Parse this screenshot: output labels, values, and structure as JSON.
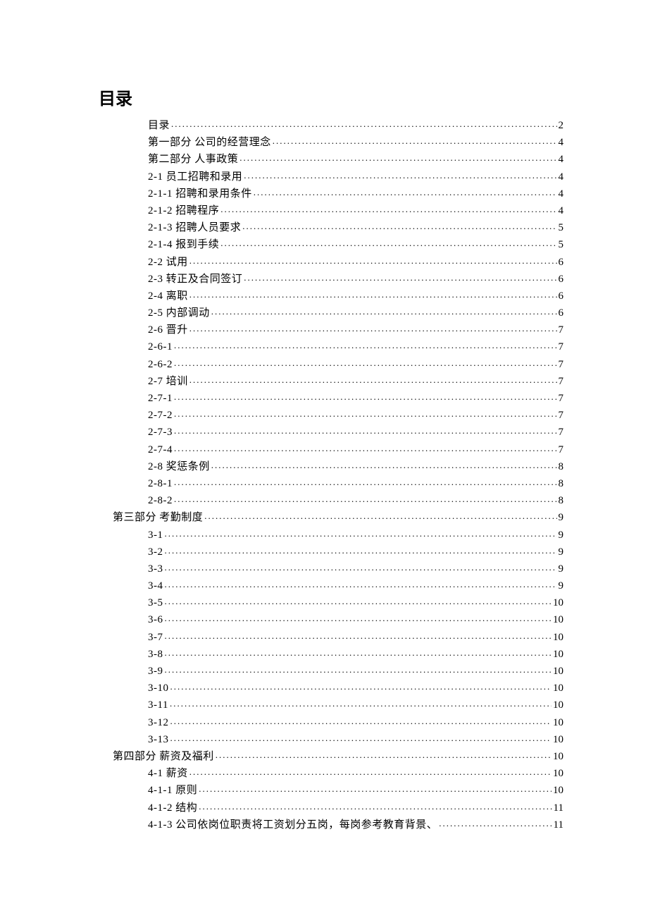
{
  "heading": "目录",
  "toc": [
    {
      "label": "目录",
      "page": "2",
      "indent": 1
    },
    {
      "label": "第一部分  公司的经营理念",
      "page": "4",
      "indent": 1
    },
    {
      "label": "第二部分  人事政策",
      "page": "4",
      "indent": 1
    },
    {
      "label": "2-1  员工招聘和录用",
      "page": "4",
      "indent": 1
    },
    {
      "label": "2-1-1  招聘和录用条件",
      "page": "4",
      "indent": 1
    },
    {
      "label": "2-1-2  招聘程序",
      "page": "4",
      "indent": 1
    },
    {
      "label": "2-1-3  招聘人员要求",
      "page": "5",
      "indent": 1
    },
    {
      "label": "2-1-4  报到手续",
      "page": "5",
      "indent": 1
    },
    {
      "label": "2-2  试用",
      "page": "6",
      "indent": 1
    },
    {
      "label": "2-3  转正及合同签订",
      "page": "6",
      "indent": 1
    },
    {
      "label": "2-4  离职",
      "page": "6",
      "indent": 1
    },
    {
      "label": "2-5  内部调动",
      "page": "6",
      "indent": 1
    },
    {
      "label": "2-6  晋升",
      "page": "7",
      "indent": 1
    },
    {
      "label": "2-6-1",
      "page": "7",
      "indent": 1
    },
    {
      "label": "2-6-2",
      "page": "7",
      "indent": 1
    },
    {
      "label": "2-7  培训",
      "page": "7",
      "indent": 1
    },
    {
      "label": "2-7-1",
      "page": "7",
      "indent": 1
    },
    {
      "label": "2-7-2",
      "page": "7",
      "indent": 1
    },
    {
      "label": "2-7-3",
      "page": "7",
      "indent": 1
    },
    {
      "label": "2-7-4",
      "page": "7",
      "indent": 1
    },
    {
      "label": "2-8  奖惩条例",
      "page": "8",
      "indent": 1
    },
    {
      "label": "2-8-1",
      "page": "8",
      "indent": 1
    },
    {
      "label": "2-8-2",
      "page": "8",
      "indent": 1
    },
    {
      "label": "第三部分  考勤制度",
      "page": "9",
      "indent": 0
    },
    {
      "label": "3-1",
      "page": "9",
      "indent": 1
    },
    {
      "label": "3-2",
      "page": "9",
      "indent": 1
    },
    {
      "label": "3-3",
      "page": "9",
      "indent": 1
    },
    {
      "label": "3-4",
      "page": "9",
      "indent": 1
    },
    {
      "label": "3-5",
      "page": "10",
      "indent": 1
    },
    {
      "label": "3-6",
      "page": "10",
      "indent": 1
    },
    {
      "label": "3-7",
      "page": "10",
      "indent": 1
    },
    {
      "label": "3-8",
      "page": "10",
      "indent": 1
    },
    {
      "label": "3-9",
      "page": "10",
      "indent": 1
    },
    {
      "label": "3-10",
      "page": "10",
      "indent": 1
    },
    {
      "label": "3-11",
      "page": "10",
      "indent": 1
    },
    {
      "label": "3-12",
      "page": "10",
      "indent": 1
    },
    {
      "label": "3-13",
      "page": "10",
      "indent": 1
    },
    {
      "label": "第四部分  薪资及福利",
      "page": "10",
      "indent": 0
    },
    {
      "label": "4-1 薪资",
      "page": "10",
      "indent": 1
    },
    {
      "label": "4-1-1  原则",
      "page": "10",
      "indent": 1
    },
    {
      "label": "4-1-2  结构",
      "page": "11",
      "indent": 1
    },
    {
      "label": "4-1-3  公司依岗位职责将工资划分五岗，每岗参考教育背景、",
      "page": "11",
      "indent": 1
    }
  ]
}
